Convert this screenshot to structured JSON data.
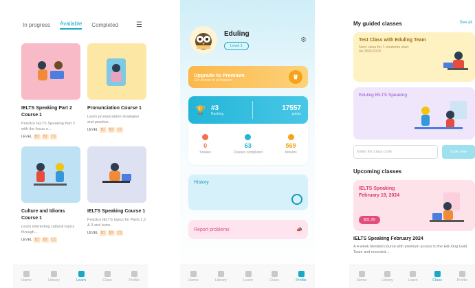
{
  "screen1": {
    "tabs": [
      "In progress",
      "Available",
      "Completed"
    ],
    "filter_icon": "filter-icon",
    "courses": [
      {
        "title": "IELTS Speaking Part 2 Course 1",
        "desc": "Practice IELTS Speaking Part 2 with the focus o...",
        "color": "#f7bac6"
      },
      {
        "title": "Pronunciation Course 1",
        "desc": "Learn pronunciation strategies and practice...",
        "color": "#fde7a5"
      },
      {
        "title": "Culture and Idioms Course 1",
        "desc": "Learn interesting cultural topics through...",
        "color": "#bfe1f4"
      },
      {
        "title": "IELTS Speaking Course 1",
        "desc": "Practice IELTS topics for Parts 1,2 & 3 and learn...",
        "color": "#dde1f1"
      }
    ],
    "level_label": "LEVEL",
    "level_badges": [
      "B1",
      "B2",
      "C1"
    ],
    "nav": [
      "Home",
      "Library",
      "Learn",
      "Class",
      "Profile"
    ]
  },
  "screen2": {
    "name": "Eduling",
    "level_btn": "Level 1",
    "premium_title": "Upgrade to Premium",
    "premium_sub": "Get access to all features",
    "rank": "#3",
    "rank_label": "Ranking",
    "points": "17557",
    "points_label": "points",
    "stats": [
      {
        "n": "0",
        "l": "Streaks",
        "c": "#f5704a"
      },
      {
        "n": "63",
        "l": "Classes completed",
        "c": "#22b5d8"
      },
      {
        "n": "569",
        "l": "Minutes",
        "c": "#f7a21b"
      }
    ],
    "history": "History",
    "report": "Report problems",
    "nav": [
      "Home",
      "Library",
      "Learn",
      "Class",
      "Profile"
    ]
  },
  "screen3": {
    "title": "My guided classes",
    "see_all": "See all",
    "test_title": "Test Class with Eduling Team",
    "test_sub": "Next class for 1 students start on 26/9/2023",
    "ielts_label": "Eduling IELTS Speaking",
    "code_placeholder": "Enter the class code",
    "code_btn": "Look now",
    "upcoming": "Upcoming classes",
    "upcoming_card": "IELTS Speaking February 19, 2024",
    "price": "$31.99",
    "upcoming_title": "IELTS Speaking February 2024",
    "upcoming_desc": "A 4-week blended course with premium access to the Edi-Xing Gold Team and recorded...",
    "nav": [
      "Home",
      "Library",
      "Learn",
      "Class",
      "Profile"
    ]
  }
}
